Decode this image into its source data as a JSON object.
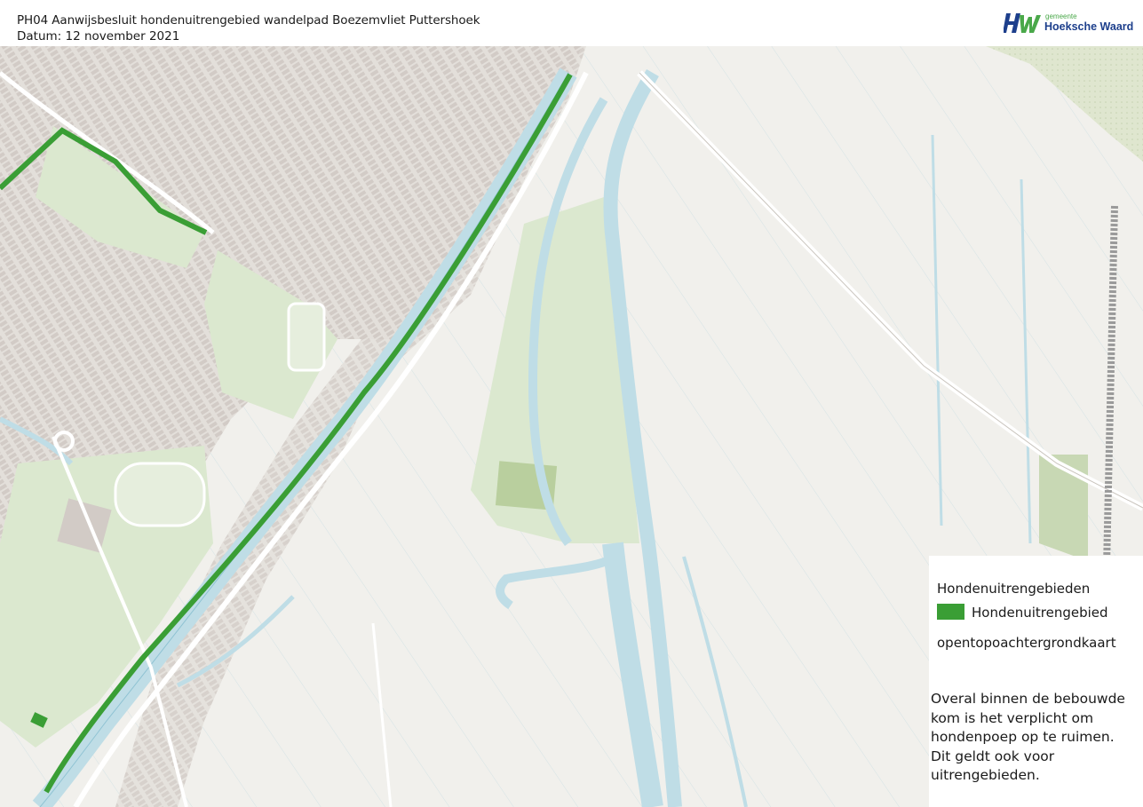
{
  "header": {
    "title": "PH04 Aanwijsbesluit hondenuitrengebied wandelpad Boezemvliet Puttershoek",
    "date": "Datum: 12 november 2021"
  },
  "logo": {
    "mark": "HW",
    "small_text": "gemeente",
    "name": "Hoeksche Waard"
  },
  "legend": {
    "title": "Hondenuitrengebieden",
    "item_label": "Hondenuitrengebied",
    "item_color": "#3a9e35",
    "basemap_label": "opentopoachtergrondkaart",
    "note": "Overal binnen de bebouwde\nkom is het verplicht om\nhondenpoep op te ruimen.\nDit geldt ook voor\nuitrengebieden."
  },
  "map": {
    "colors": {
      "land": "#f1f0ec",
      "water": "#bfdde6",
      "water_edge": "#8fc3d3",
      "urban": "#e3dfda",
      "building": "#d2cbc6",
      "green": "#dbe8cf",
      "road": "#ffffff",
      "dog_area": "#3a9e35"
    }
  }
}
